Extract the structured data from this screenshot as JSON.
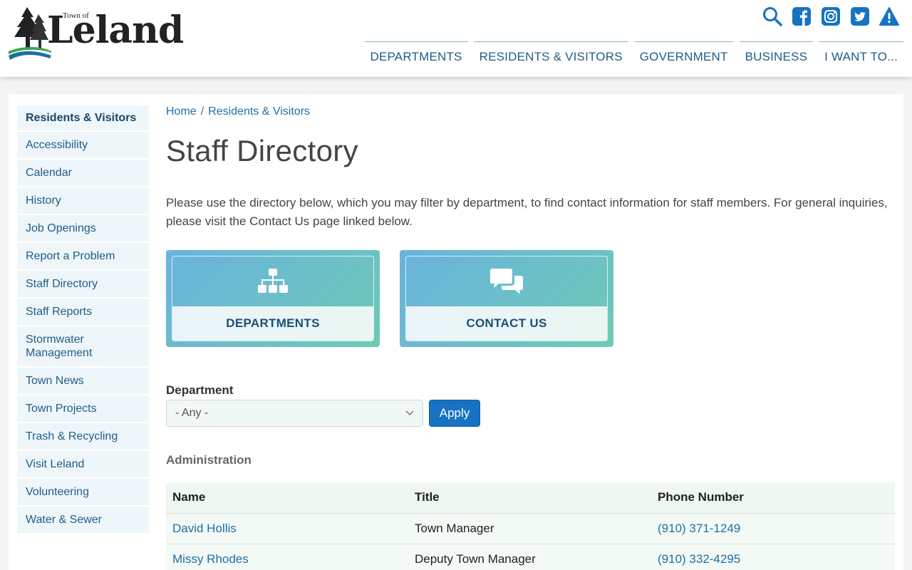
{
  "header": {
    "logo_small": "Town of",
    "logo_name": "Leland",
    "icons": [
      "search-icon",
      "facebook-icon",
      "instagram-icon",
      "twitter-icon",
      "alert-icon"
    ],
    "nav": [
      "DEPARTMENTS",
      "RESIDENTS & VISITORS",
      "GOVERNMENT",
      "BUSINESS",
      "I WANT TO..."
    ]
  },
  "sidebar": {
    "heading": "Residents & Visitors",
    "items": [
      {
        "label": "Accessibility"
      },
      {
        "label": "Calendar"
      },
      {
        "label": "History"
      },
      {
        "label": "Job Openings"
      },
      {
        "label": "Report a Problem"
      },
      {
        "label": "Staff Directory"
      },
      {
        "label": "Staff Reports"
      },
      {
        "label": "Stormwater Management"
      },
      {
        "label": "Town News"
      },
      {
        "label": "Town Projects"
      },
      {
        "label": "Trash & Recycling"
      },
      {
        "label": "Visit Leland"
      },
      {
        "label": "Volunteering"
      },
      {
        "label": "Water & Sewer"
      }
    ]
  },
  "breadcrumb": {
    "home": "Home",
    "sep": "/",
    "current": "Residents & Visitors"
  },
  "page": {
    "title": "Staff Directory",
    "intro": "Please use the directory below, which you may filter by department, to find contact information for staff members. For general inquiries, please visit the Contact Us page linked below."
  },
  "tiles": [
    {
      "label": "DEPARTMENTS",
      "icon": "org-chart-icon"
    },
    {
      "label": "CONTACT US",
      "icon": "chat-bubbles-icon"
    }
  ],
  "filter": {
    "label": "Department",
    "value": "- Any -",
    "apply": "Apply"
  },
  "section": "Administration",
  "table": {
    "headers": [
      "Name",
      "Title",
      "Phone Number"
    ],
    "rows": [
      [
        "David Hollis",
        "Town Manager",
        "(910) 371-1249"
      ],
      [
        "Missy Rhodes",
        "Deputy Town Manager",
        "(910) 332-4295"
      ]
    ]
  },
  "colors": {
    "brand_blue": "#1f5d86",
    "link": "#1f6fa5",
    "button": "#1673c3"
  }
}
